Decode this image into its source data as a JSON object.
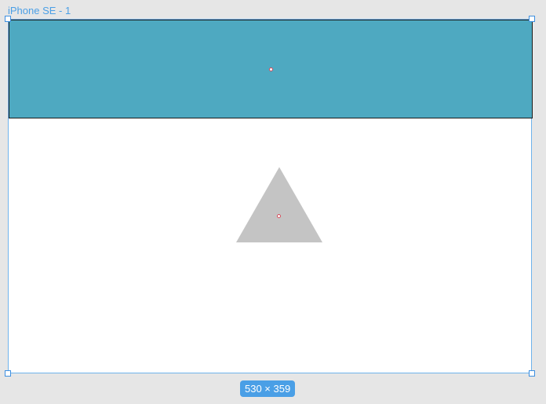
{
  "artboard": {
    "title": "iPhone SE - 1",
    "dimensions_label": "530 × 359"
  },
  "shapes": {
    "header_rectangle": {
      "fill": "#4ea9c1",
      "stroke": "#1c1c1c"
    },
    "triangle": {
      "fill": "#c4c4c4"
    }
  },
  "colors": {
    "canvas_background": "#e6e6e6",
    "selection_accent": "#4a9fe6",
    "center_marker": "#d64b5a"
  },
  "icons": [
    "center-point-marker",
    "selection-handle"
  ]
}
